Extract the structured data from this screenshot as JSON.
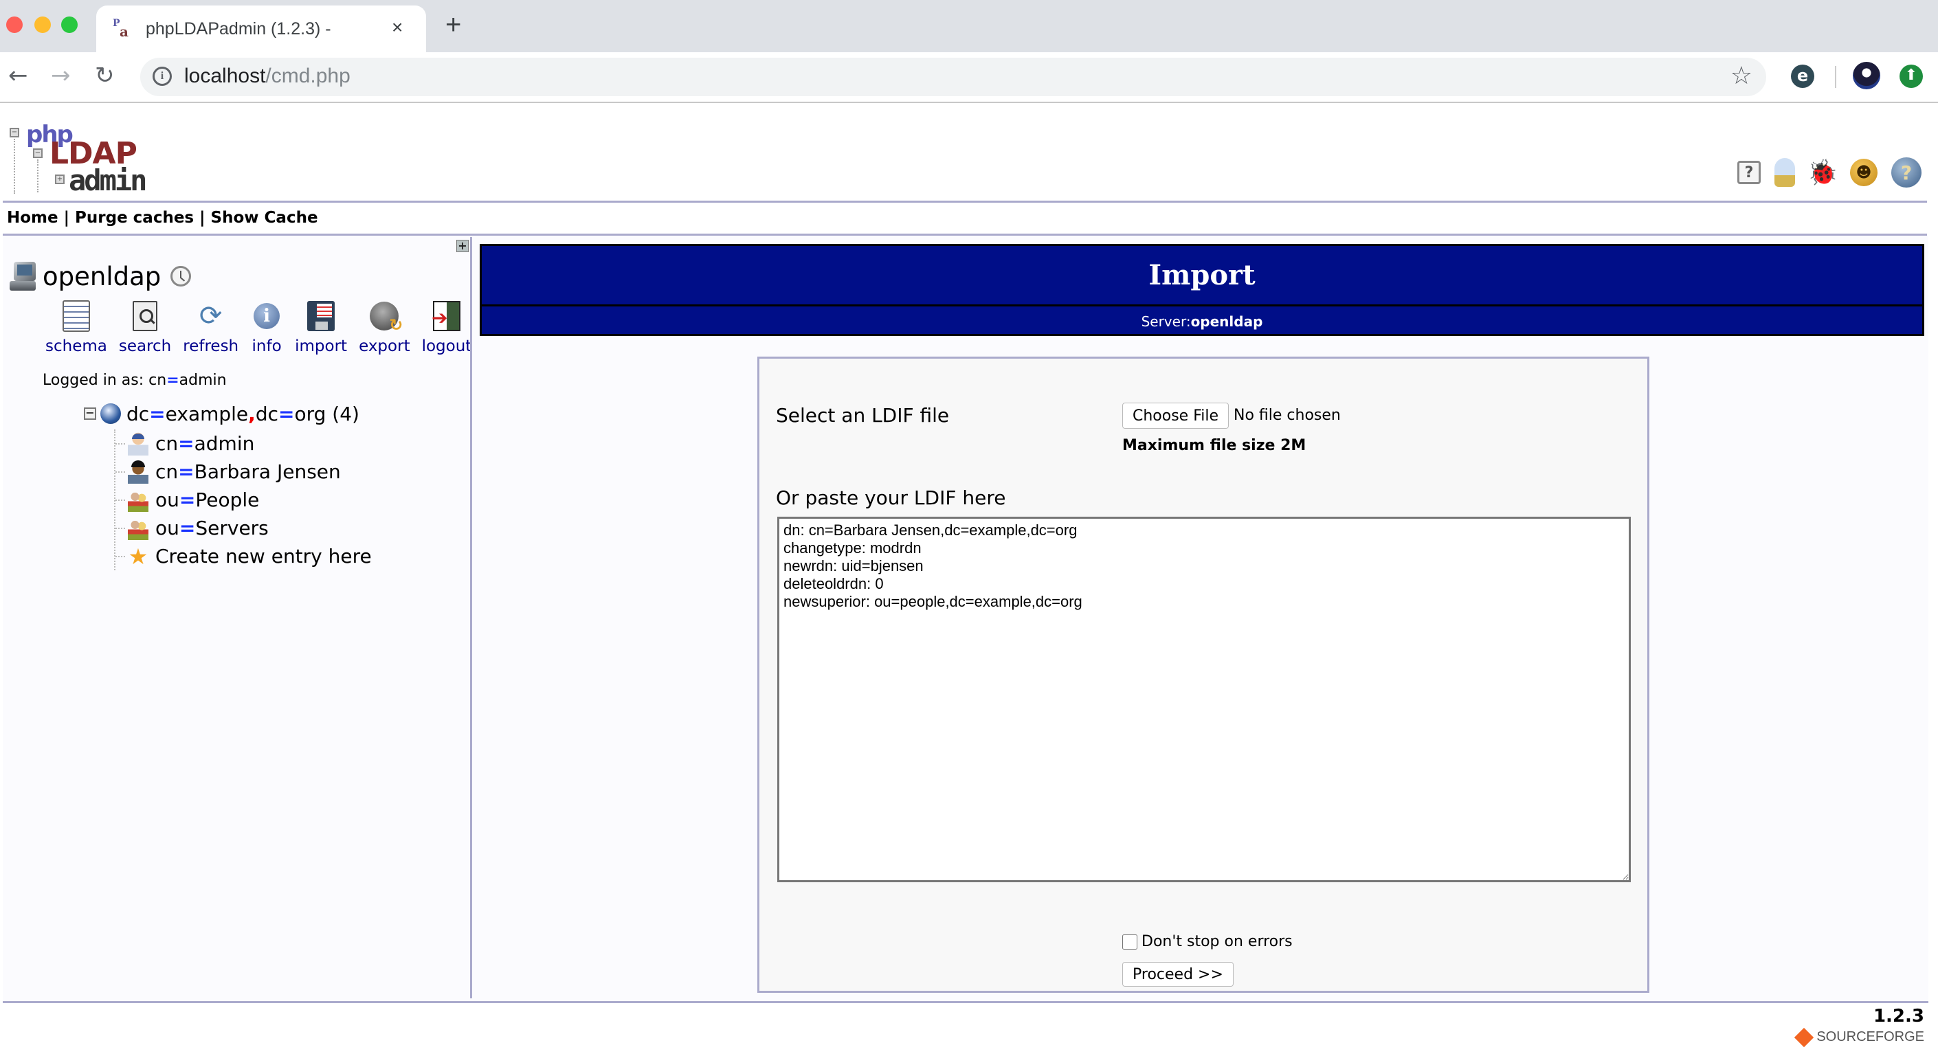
{
  "browser": {
    "tab_title": "phpLDAPadmin (1.2.3) -",
    "tab_close": "×",
    "new_tab": "+",
    "url_host": "localhost",
    "url_path": "/cmd.php",
    "back": "←",
    "forward": "→",
    "reload": "↻",
    "bookmark": "☆",
    "extension_letter": "e",
    "update_arrow": "⬆"
  },
  "app": {
    "logo": {
      "php": "php",
      "ldap": "LDAP",
      "admin": "admin"
    },
    "header_icons": [
      "help-question",
      "idea-lightbulb",
      "bug-report",
      "smiley-feedback",
      "help-circle"
    ],
    "nav": {
      "home": "Home",
      "purge": "Purge caches",
      "show_cache": "Show Cache",
      "separator": "|"
    },
    "version": "1.2.3",
    "sourceforge": "SOURCEFORGE"
  },
  "sidebar": {
    "expand": "+",
    "server_name": "openldap",
    "actions": [
      {
        "label": "schema"
      },
      {
        "label": "search"
      },
      {
        "label": "refresh"
      },
      {
        "label": "info"
      },
      {
        "label": "import"
      },
      {
        "label": "export"
      },
      {
        "label": "logout"
      }
    ],
    "logged_in_prefix": "Logged in as: ",
    "logged_in_attr": "cn",
    "logged_in_eq": "=",
    "logged_in_value": "admin",
    "tree": {
      "toggle": "−",
      "root": {
        "a1": "dc",
        "v1": "example",
        "a2": "dc",
        "v2": "org",
        "count": "(4)"
      },
      "children": [
        {
          "attr": "cn",
          "value": "admin",
          "icon": "admin-user"
        },
        {
          "attr": "cn",
          "value": "Barbara Jensen",
          "icon": "person"
        },
        {
          "attr": "ou",
          "value": "People",
          "icon": "group"
        },
        {
          "attr": "ou",
          "value": "Servers",
          "icon": "group"
        }
      ],
      "create_label": "Create new entry here"
    }
  },
  "main": {
    "title": "Import",
    "server_label": "Server: ",
    "server_value": "openldap",
    "select_file_label": "Select an LDIF file",
    "choose_file_button": "Choose File",
    "no_file_text": "No file chosen",
    "max_size": "Maximum file size 2M",
    "paste_label": "Or paste your LDIF here",
    "ldif_text": "dn: cn=Barbara Jensen,dc=example,dc=org\nchangetype: modrdn\nnewrdn: uid=bjensen\ndeleteoldrdn: 0\nnewsuperior: ou=people,dc=example,dc=org",
    "dont_stop_label": "Don't stop on errors",
    "dont_stop_checked": false,
    "proceed_button": "Proceed >>"
  },
  "colors": {
    "banner_bg": "#000e88",
    "link_blue": "#00008b",
    "rule": "#aaaacc",
    "eq_blue": "#1a33ff",
    "comma_red": "#e00000"
  }
}
